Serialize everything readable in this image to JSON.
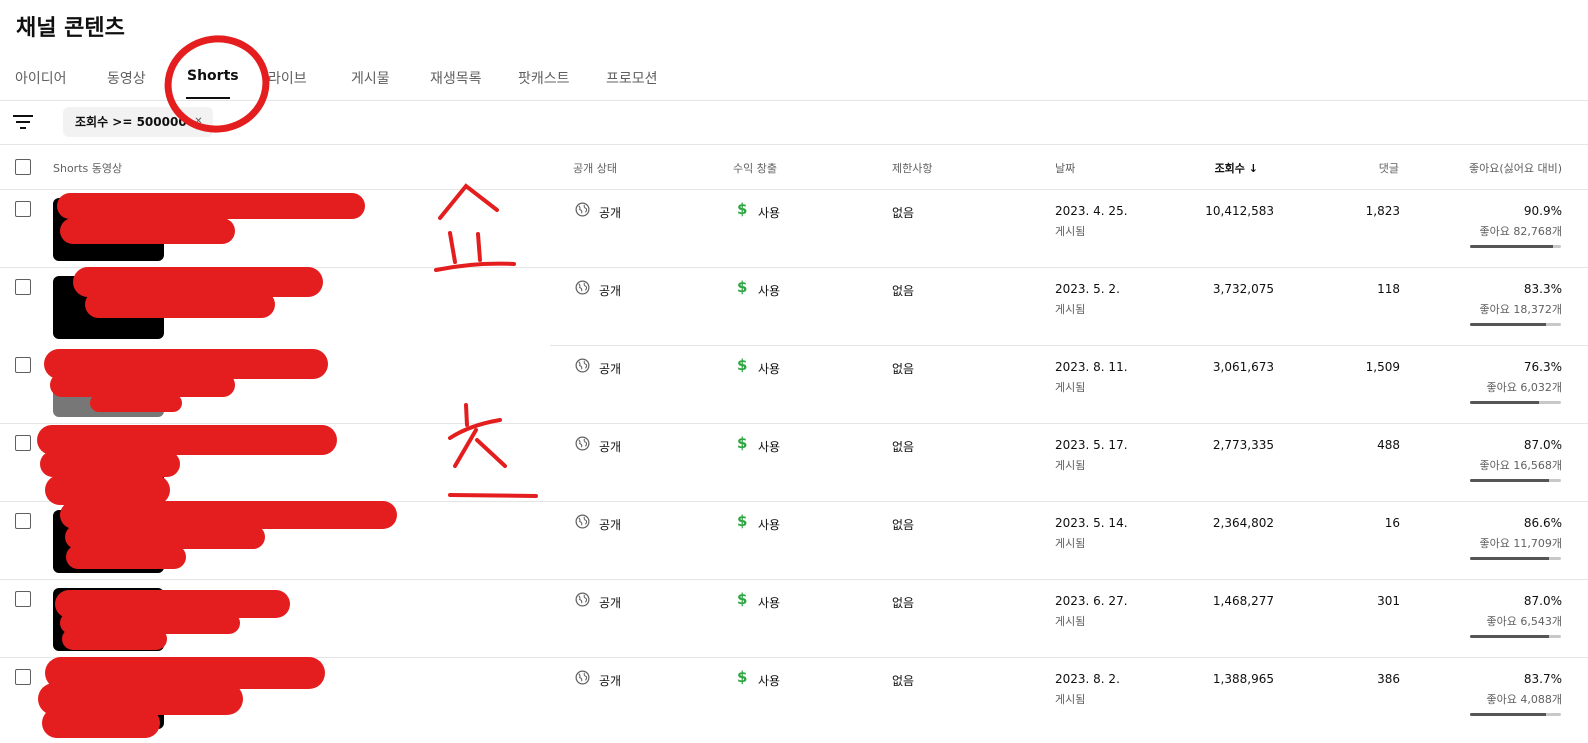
{
  "page_title": "채널 콘텐츠",
  "tabs": [
    {
      "label": "아이디어"
    },
    {
      "label": "동영상"
    },
    {
      "label": "Shorts"
    },
    {
      "label": "라이브"
    },
    {
      "label": "게시물"
    },
    {
      "label": "재생목록"
    },
    {
      "label": "팟캐스트"
    },
    {
      "label": "프로모션"
    }
  ],
  "active_tab": "Shorts",
  "filter": {
    "chip_label": "조회수 >= 500000",
    "icon": "filter-icon"
  },
  "table": {
    "headers": {
      "video": "Shorts 동영상",
      "visibility": "공개 상태",
      "monetization": "수익 창출",
      "restrictions": "제한사항",
      "date": "날짜",
      "views": "조회수",
      "comments": "댓글",
      "likes": "좋아요(싫어요 대비)"
    },
    "sort_icon": "arrow-down-icon",
    "rows": [
      {
        "visibility": "공개",
        "monetization": "사용",
        "restrictions": "없음",
        "date": "2023. 4. 25.",
        "date_status": "게시됨",
        "views": "10,412,583",
        "comments": "1,823",
        "like_pct": "90.9%",
        "like_count": "좋아요 82,768개",
        "like_ratio": 0.909
      },
      {
        "visibility": "공개",
        "monetization": "사용",
        "restrictions": "없음",
        "date": "2023. 5. 2.",
        "date_status": "게시됨",
        "views": "3,732,075",
        "comments": "118",
        "like_pct": "83.3%",
        "like_count": "좋아요 18,372개",
        "like_ratio": 0.833
      },
      {
        "visibility": "공개",
        "monetization": "사용",
        "restrictions": "없음",
        "date": "2023. 8. 11.",
        "date_status": "게시됨",
        "views": "3,061,673",
        "comments": "1,509",
        "like_pct": "76.3%",
        "like_count": "좋아요 6,032개",
        "like_ratio": 0.763
      },
      {
        "visibility": "공개",
        "monetization": "사용",
        "restrictions": "없음",
        "date": "2023. 5. 17.",
        "date_status": "게시됨",
        "views": "2,773,335",
        "comments": "488",
        "like_pct": "87.0%",
        "like_count": "좋아요 16,568개",
        "like_ratio": 0.87
      },
      {
        "visibility": "공개",
        "monetization": "사용",
        "restrictions": "없음",
        "date": "2023. 5. 14.",
        "date_status": "게시됨",
        "views": "2,364,802",
        "comments": "16",
        "like_pct": "86.6%",
        "like_count": "좋아요 11,709개",
        "like_ratio": 0.866
      },
      {
        "visibility": "공개",
        "monetization": "사용",
        "restrictions": "없음",
        "date": "2023. 6. 27.",
        "date_status": "게시됨",
        "views": "1,468,277",
        "comments": "301",
        "like_pct": "87.0%",
        "like_count": "좋아요 6,543개",
        "like_ratio": 0.87
      },
      {
        "visibility": "공개",
        "monetization": "사용",
        "restrictions": "없음",
        "date": "2023. 8. 2.",
        "date_status": "게시됨",
        "views": "1,388,965",
        "comments": "386",
        "like_pct": "83.7%",
        "like_count": "좋아요 4,088개",
        "like_ratio": 0.837
      }
    ]
  },
  "colors": {
    "monetization_green": "#2ba640",
    "annotation_red": "#e41e1e",
    "like_bar": "#555555"
  }
}
